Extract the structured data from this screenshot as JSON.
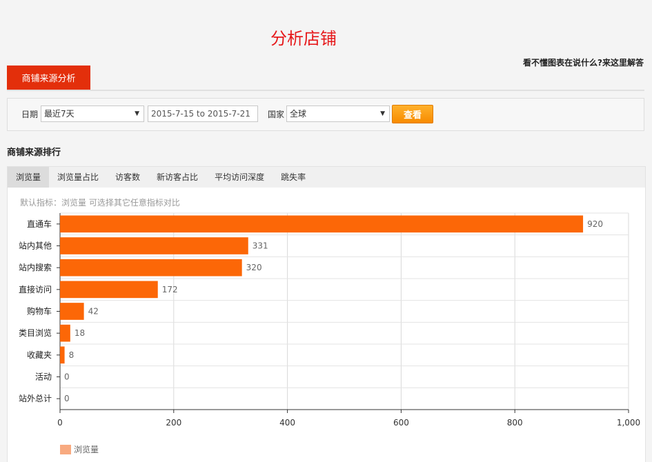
{
  "page": {
    "title": "分析店铺",
    "help_link": "看不懂图表在说什么?来这里解答"
  },
  "main_tab": {
    "label": "商铺来源分析"
  },
  "filters": {
    "date_label": "日期",
    "date_range_select": "最近7天",
    "date_range_value": "2015-7-15 to 2015-7-21",
    "country_label": "国家",
    "country_select": "全球",
    "query_button": "查看"
  },
  "section": {
    "title": "商铺来源排行"
  },
  "metric_tabs": [
    {
      "label": "浏览量",
      "active": true
    },
    {
      "label": "浏览量占比",
      "active": false
    },
    {
      "label": "访客数",
      "active": false
    },
    {
      "label": "新访客占比",
      "active": false
    },
    {
      "label": "平均访问深度",
      "active": false
    },
    {
      "label": "跳失率",
      "active": false
    }
  ],
  "hint": "默认指标：浏览量 可选择其它任意指标对比",
  "colors": {
    "bar": "#fc6707",
    "legend": "#f8aa80",
    "accent": "#e32f0b",
    "title": "#e6181a"
  },
  "chart_data": {
    "type": "bar",
    "orientation": "horizontal",
    "categories": [
      "直通车",
      "站内其他",
      "站内搜索",
      "直接访问",
      "购物车",
      "类目浏览",
      "收藏夹",
      "活动",
      "站外总计"
    ],
    "series": [
      {
        "name": "浏览量",
        "values": [
          920,
          331,
          320,
          172,
          42,
          18,
          8,
          0,
          0
        ]
      }
    ],
    "xlim": [
      0,
      1000
    ],
    "xticks": [
      0,
      200,
      400,
      600,
      800,
      1000
    ],
    "xtick_labels": [
      "0",
      "200",
      "400",
      "600",
      "800",
      "1,000"
    ],
    "grid": true,
    "legend": "bottom-left"
  }
}
